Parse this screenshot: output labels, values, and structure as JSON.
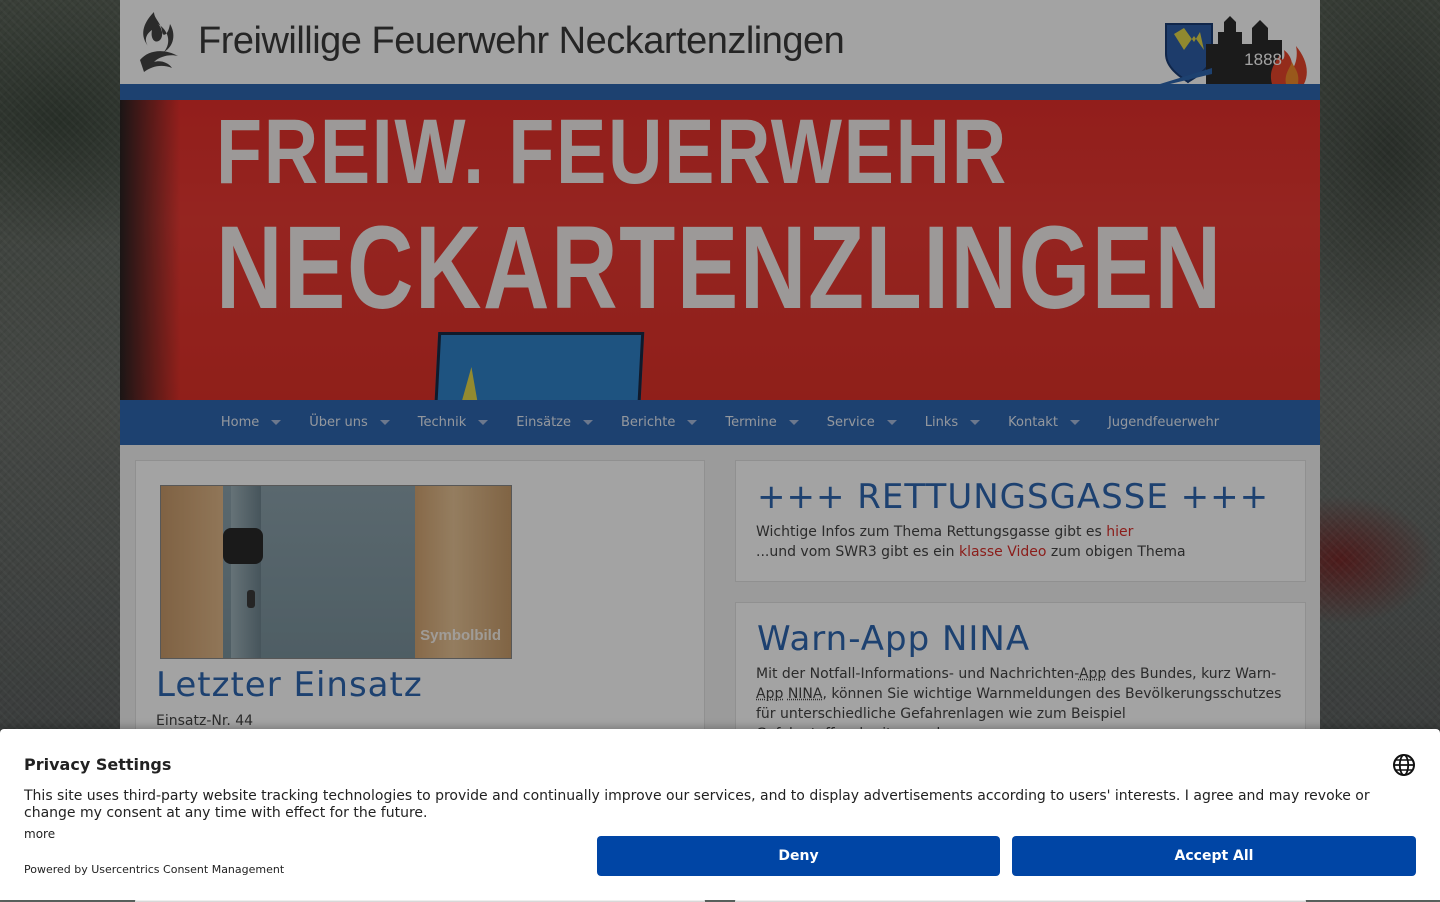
{
  "header": {
    "site_title": "Freiwillige Feuerwehr Neckartenzlingen",
    "crest_year": "1888"
  },
  "hero": {
    "line1": "FREIW. FEUERWEHR",
    "line2": "NECKARTENZLINGEN"
  },
  "nav": {
    "items": [
      {
        "label": "Home",
        "has_dropdown": true
      },
      {
        "label": "Über uns",
        "has_dropdown": true
      },
      {
        "label": "Technik",
        "has_dropdown": true
      },
      {
        "label": "Einsätze",
        "has_dropdown": true
      },
      {
        "label": "Berichte",
        "has_dropdown": true
      },
      {
        "label": "Termine",
        "has_dropdown": true
      },
      {
        "label": "Service",
        "has_dropdown": true
      },
      {
        "label": "Links",
        "has_dropdown": true
      },
      {
        "label": "Kontakt",
        "has_dropdown": true
      },
      {
        "label": "Jugendfeuerwehr",
        "has_dropdown": false
      }
    ]
  },
  "left_card": {
    "image_caption": "Symbolbild",
    "title": "Letzter Einsatz",
    "einsatz_nr": "Einsatz-Nr. 44"
  },
  "rettungsgasse": {
    "title": "+++ RETTUNGSGASSE +++",
    "line1_prefix": "Wichtige Infos zum Thema Rettungsgasse gibt es ",
    "line1_link": "hier",
    "line2_prefix": "...und vom SWR3 gibt es ein ",
    "line2_link": "klasse Video",
    "line2_suffix": " zum obigen Thema"
  },
  "nina": {
    "title": "Warn-App NINA",
    "text_1": "Mit der Notfall-Informations- und Nachrichten-",
    "abbr_app_1": "App",
    "text_2": " des Bundes, kurz Warn-",
    "abbr_app_2": "App",
    "abbr_nina": "NINA",
    "text_3": ", können Sie wichtige Warnmeldungen des Bevölkerungsschutzes für unterschiedliche Gefahrenlagen wie zum Beispiel Gefahrstoffausbreitung oder"
  },
  "consent": {
    "title": "Privacy Settings",
    "text": "This site uses third-party website tracking technologies to provide and continually improve our services, and to display advertisements according to users' interests. I agree and may revoke or change my consent at any time with effect for the future.",
    "more": "more",
    "powered_by": "Powered by Usercentrics Consent Management",
    "deny_label": "Deny",
    "accept_label": "Accept All",
    "button_color": "#0045a5"
  },
  "colors": {
    "nav_blue": "#2e66b0",
    "hero_red": "#e52f2b",
    "link_red": "#d9302b"
  }
}
